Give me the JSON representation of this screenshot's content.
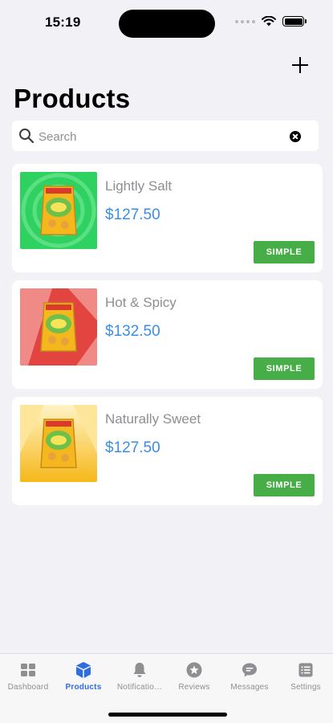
{
  "status_bar": {
    "time": "15:19"
  },
  "header": {
    "title": "Products",
    "add_icon": "plus-icon"
  },
  "search": {
    "placeholder": "Search",
    "value": ""
  },
  "products": [
    {
      "name": "Lightly Salt",
      "price": "$127.50",
      "type": "SIMPLE",
      "thumb_color": "#2fd160"
    },
    {
      "name": "Hot & Spicy",
      "price": "$132.50",
      "type": "SIMPLE",
      "thumb_color": "#e2453f"
    },
    {
      "name": "Naturally Sweet",
      "price": "$127.50",
      "type": "SIMPLE",
      "thumb_color": "#f6c22a"
    }
  ],
  "tabs": [
    {
      "label": "Dashboard",
      "icon": "dashboard-icon",
      "active": false
    },
    {
      "label": "Products",
      "icon": "products-icon",
      "active": true
    },
    {
      "label": "Notificatio…",
      "icon": "bell-icon",
      "active": false
    },
    {
      "label": "Reviews",
      "icon": "star-icon",
      "active": false
    },
    {
      "label": "Messages",
      "icon": "message-icon",
      "active": false
    },
    {
      "label": "Settings",
      "icon": "settings-icon",
      "active": false
    }
  ],
  "colors": {
    "accent": "#2f6ee0",
    "price": "#3a8ee6",
    "badge": "#46ad47",
    "background": "#f2f2f6"
  }
}
